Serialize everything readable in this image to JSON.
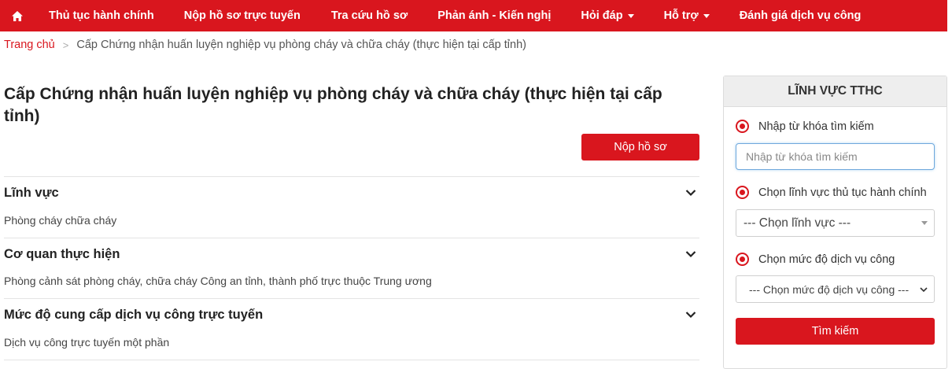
{
  "nav": {
    "items": [
      {
        "label": "Thủ tục hành chính",
        "dropdown": false
      },
      {
        "label": "Nộp hồ sơ trực tuyến",
        "dropdown": false
      },
      {
        "label": "Tra cứu hồ sơ",
        "dropdown": false
      },
      {
        "label": "Phản ánh - Kiến nghị",
        "dropdown": false
      },
      {
        "label": "Hỏi đáp",
        "dropdown": true
      },
      {
        "label": "Hỗ trợ",
        "dropdown": true
      },
      {
        "label": "Đánh giá dịch vụ công",
        "dropdown": false
      }
    ],
    "home_icon": "home-icon",
    "color": "#d9161e"
  },
  "breadcrumb": {
    "home": "Trang chủ",
    "separator": ">",
    "current": "Cấp Chứng nhận huấn luyện nghiệp vụ phòng cháy và chữa cháy (thực hiện tại cấp tỉnh)"
  },
  "main": {
    "title": "Cấp Chứng nhận huấn luyện nghiệp vụ phòng cháy và chữa cháy (thực hiện tại cấp tỉnh)",
    "submit_label": "Nộp hồ sơ",
    "sections": [
      {
        "label": "Lĩnh vực",
        "value": "Phòng cháy chữa cháy"
      },
      {
        "label": "Cơ quan thực hiện",
        "value": "Phòng cảnh sát phòng cháy, chữa cháy Công an tỉnh, thành phố trực thuộc Trung ương"
      },
      {
        "label": "Mức độ cung cấp dịch vụ công trực tuyến",
        "value": "Dịch vụ công trực tuyến một phần"
      }
    ]
  },
  "sidebar": {
    "title": "LĨNH VỰC TTHC",
    "keyword_radio": "Nhập từ khóa tìm kiếm",
    "keyword_placeholder": "Nhập từ khóa tìm kiếm",
    "field_radio": "Chọn lĩnh vực thủ tục hành chính",
    "field_select": "--- Chọn lĩnh vực ---",
    "level_radio": "Chọn mức độ dịch vụ công",
    "level_select": "--- Chọn mức độ dịch vụ công ---",
    "search_label": "Tìm kiếm"
  }
}
